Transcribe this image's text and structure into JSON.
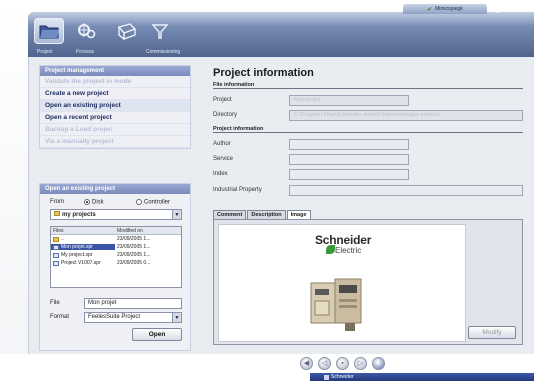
{
  "toolbar": {
    "buttons": [
      {
        "name": "project",
        "label": "Project",
        "active": true
      },
      {
        "name": "process",
        "label": "Process",
        "active": false
      },
      {
        "name": "connect",
        "label": "",
        "active": false
      },
      {
        "name": "commission",
        "label": "Commissioning",
        "active": false
      }
    ],
    "top_tab_label": "Mimicspiegé",
    "help": "?"
  },
  "left": {
    "project_management": {
      "header": "Project management",
      "items": [
        {
          "label": "Validate the project in mode",
          "enabled": false
        },
        {
          "label": "Create a new project",
          "enabled": true
        },
        {
          "label": "Open an existing project",
          "enabled": true,
          "selected": true
        },
        {
          "label": "Open a recent project",
          "enabled": true
        },
        {
          "label": "Backup a Load projec",
          "enabled": false
        },
        {
          "label": "Via a manually project",
          "enabled": false
        }
      ]
    },
    "open_existing": {
      "header": "Open an existing project",
      "from_label": "From",
      "disk_label": "Disk",
      "controller_label": "Controller",
      "folder": "my projects",
      "columns": [
        "Files",
        "Modified on"
      ],
      "files": [
        {
          "name": "..",
          "date": "23/09/2005 1...",
          "icon": "folder"
        },
        {
          "name": "Mon projet.spr",
          "date": "23/09/2005 1...",
          "icon": "document",
          "selected": true
        },
        {
          "name": "My project.spr",
          "date": "23/09/2005 1...",
          "icon": "document"
        },
        {
          "name": "Project V1007.spr",
          "date": "23/09/2005 0...",
          "icon": "document"
        }
      ],
      "file_label": "File",
      "file_value": "Mon projet",
      "format_label": "Format",
      "format_value": "FeelesSuite Project",
      "open_button": "Open"
    }
  },
  "right": {
    "title": "Project information",
    "file_info_header": "File information",
    "project_label": "Project",
    "project_value": "Mon projet",
    "directory_label": "Directory",
    "directory_value": "C:\\Program Files\\Schneider electric\\Telemecanique projects",
    "project_info_header": "Project information",
    "author_label": "Author",
    "service_label": "Service",
    "index_label": "Index",
    "industrial_label": "Industrial Property",
    "tabs": [
      {
        "label": "Comment",
        "active": false
      },
      {
        "label": "Description",
        "active": false
      },
      {
        "label": "Image",
        "active": true
      }
    ],
    "logo_main": "Schneider",
    "logo_sub": "Electric",
    "modify_button": "Modify"
  },
  "bottom": {
    "taskbar_item": "Schneider"
  }
}
